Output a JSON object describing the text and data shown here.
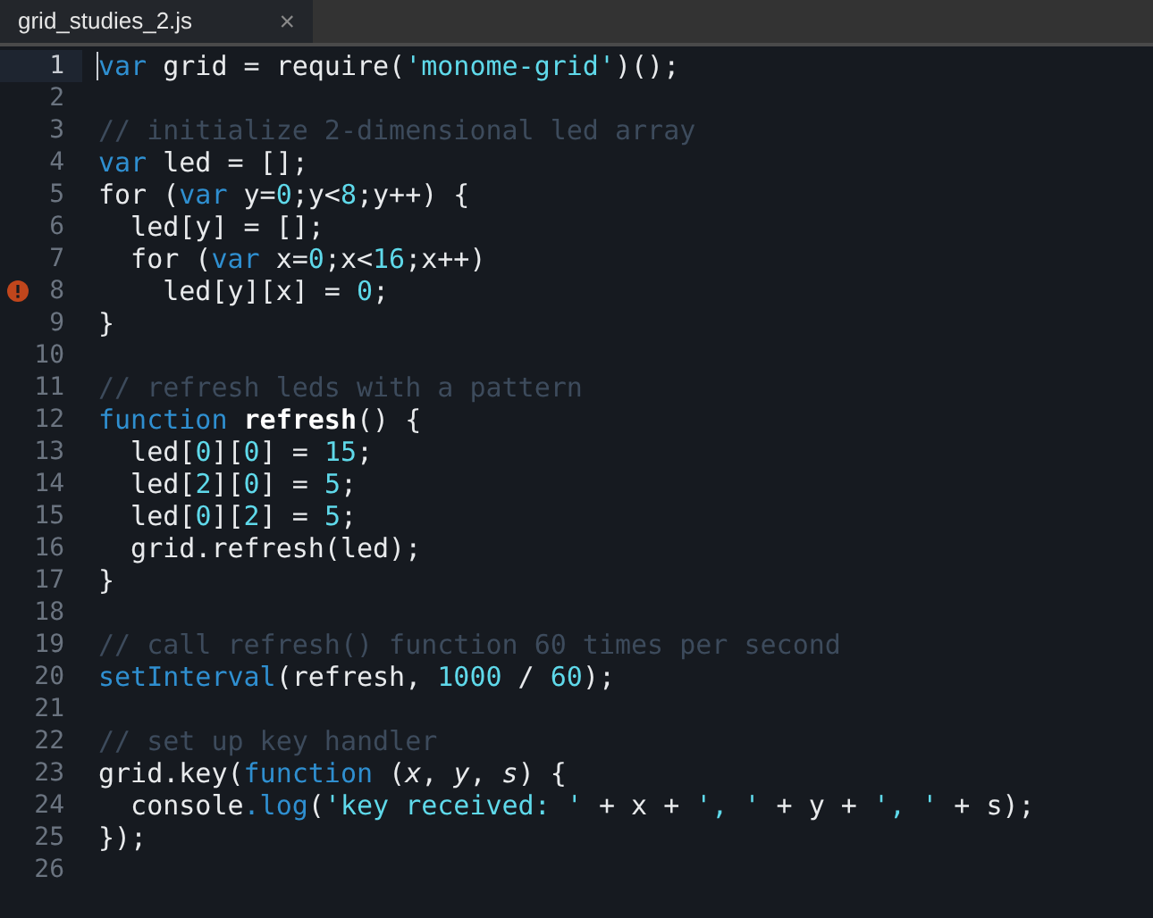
{
  "tabs": [
    {
      "label": "grid_studies_2.js",
      "close": "×",
      "selected": true
    }
  ],
  "lines": [
    {
      "number": "1",
      "current": true,
      "error": false,
      "tokens": [
        {
          "kind": "kw",
          "text": "var"
        },
        {
          "kind": "txt",
          "text": " grid = require("
        },
        {
          "kind": "str",
          "text": "'monome-grid'"
        },
        {
          "kind": "txt",
          "text": ")();"
        }
      ]
    },
    {
      "number": "2",
      "current": false,
      "error": false
    },
    {
      "number": "3",
      "current": false,
      "error": false,
      "tokens": [
        {
          "kind": "com",
          "text": "// initialize 2-dimensional led array"
        }
      ]
    },
    {
      "number": "4",
      "current": false,
      "error": false,
      "tokens": [
        {
          "kind": "kw",
          "text": "var"
        },
        {
          "kind": "txt",
          "text": " led = [];"
        }
      ]
    },
    {
      "number": "5",
      "current": false,
      "error": false,
      "tokens": [
        {
          "kind": "txt",
          "text": "for ("
        },
        {
          "kind": "kw",
          "text": "var"
        },
        {
          "kind": "txt",
          "text": " y="
        },
        {
          "kind": "num",
          "text": "0"
        },
        {
          "kind": "txt",
          "text": ";y<"
        },
        {
          "kind": "num",
          "text": "8"
        },
        {
          "kind": "txt",
          "text": ";y++) {"
        }
      ]
    },
    {
      "number": "6",
      "current": false,
      "error": false,
      "tokens": [
        {
          "kind": "txt",
          "text": "  led[y] = [];"
        }
      ]
    },
    {
      "number": "7",
      "current": false,
      "error": false,
      "tokens": [
        {
          "kind": "txt",
          "text": "  for ("
        },
        {
          "kind": "kw",
          "text": "var"
        },
        {
          "kind": "txt",
          "text": " x="
        },
        {
          "kind": "num",
          "text": "0"
        },
        {
          "kind": "txt",
          "text": ";x<"
        },
        {
          "kind": "num",
          "text": "16"
        },
        {
          "kind": "txt",
          "text": ";x++)"
        }
      ]
    },
    {
      "number": "8",
      "current": false,
      "error": true,
      "tokens": [
        {
          "kind": "txt",
          "text": "    led[y][x] = "
        },
        {
          "kind": "num",
          "text": "0"
        },
        {
          "kind": "txt",
          "text": ";"
        }
      ]
    },
    {
      "number": "9",
      "current": false,
      "error": false,
      "tokens": [
        {
          "kind": "txt",
          "text": "}"
        }
      ]
    },
    {
      "number": "10",
      "current": false,
      "error": false
    },
    {
      "number": "11",
      "current": false,
      "error": false,
      "tokens": [
        {
          "kind": "com",
          "text": "// refresh leds with a pattern"
        }
      ]
    },
    {
      "number": "12",
      "current": false,
      "error": false,
      "tokens": [
        {
          "kind": "kw",
          "text": "function"
        },
        {
          "kind": "fn",
          "text": " refresh"
        },
        {
          "kind": "txt",
          "text": "() {"
        }
      ]
    },
    {
      "number": "13",
      "current": false,
      "error": false,
      "tokens": [
        {
          "kind": "txt",
          "text": "  led["
        },
        {
          "kind": "num",
          "text": "0"
        },
        {
          "kind": "txt",
          "text": "]["
        },
        {
          "kind": "num",
          "text": "0"
        },
        {
          "kind": "txt",
          "text": "] = "
        },
        {
          "kind": "num",
          "text": "15"
        },
        {
          "kind": "txt",
          "text": ";"
        }
      ]
    },
    {
      "number": "14",
      "current": false,
      "error": false,
      "tokens": [
        {
          "kind": "txt",
          "text": "  led["
        },
        {
          "kind": "num",
          "text": "2"
        },
        {
          "kind": "txt",
          "text": "]["
        },
        {
          "kind": "num",
          "text": "0"
        },
        {
          "kind": "txt",
          "text": "] = "
        },
        {
          "kind": "num",
          "text": "5"
        },
        {
          "kind": "txt",
          "text": ";"
        }
      ]
    },
    {
      "number": "15",
      "current": false,
      "error": false,
      "tokens": [
        {
          "kind": "txt",
          "text": "  led["
        },
        {
          "kind": "num",
          "text": "0"
        },
        {
          "kind": "txt",
          "text": "]["
        },
        {
          "kind": "num",
          "text": "2"
        },
        {
          "kind": "txt",
          "text": "] = "
        },
        {
          "kind": "num",
          "text": "5"
        },
        {
          "kind": "txt",
          "text": ";"
        }
      ]
    },
    {
      "number": "16",
      "current": false,
      "error": false,
      "tokens": [
        {
          "kind": "txt",
          "text": "  grid.refresh(led);"
        }
      ]
    },
    {
      "number": "17",
      "current": false,
      "error": false,
      "tokens": [
        {
          "kind": "txt",
          "text": "}"
        }
      ]
    },
    {
      "number": "18",
      "current": false,
      "error": false
    },
    {
      "number": "19",
      "current": false,
      "error": false,
      "tokens": [
        {
          "kind": "com",
          "text": "// call refresh() function 60 times per second"
        }
      ]
    },
    {
      "number": "20",
      "current": false,
      "error": false,
      "tokens": [
        {
          "kind": "kw",
          "text": "setInterval"
        },
        {
          "kind": "txt",
          "text": "(refresh, "
        },
        {
          "kind": "num",
          "text": "1000"
        },
        {
          "kind": "txt",
          "text": " / "
        },
        {
          "kind": "num",
          "text": "60"
        },
        {
          "kind": "txt",
          "text": ");"
        }
      ]
    },
    {
      "number": "21",
      "current": false,
      "error": false
    },
    {
      "number": "22",
      "current": false,
      "error": false,
      "tokens": [
        {
          "kind": "com",
          "text": "// set up key handler"
        }
      ]
    },
    {
      "number": "23",
      "current": false,
      "error": false,
      "tokens": [
        {
          "kind": "txt",
          "text": "grid.key("
        },
        {
          "kind": "kw",
          "text": "function"
        },
        {
          "kind": "txt",
          "text": " ("
        },
        {
          "kind": "param",
          "text": "x"
        },
        {
          "kind": "txt",
          "text": ", "
        },
        {
          "kind": "param",
          "text": "y"
        },
        {
          "kind": "txt",
          "text": ", "
        },
        {
          "kind": "param",
          "text": "s"
        },
        {
          "kind": "txt",
          "text": ") {"
        }
      ]
    },
    {
      "number": "24",
      "current": false,
      "error": false,
      "tokens": [
        {
          "kind": "txt",
          "text": "  console"
        },
        {
          "kind": "kw",
          "text": ".log"
        },
        {
          "kind": "txt",
          "text": "("
        },
        {
          "kind": "str",
          "text": "'key received: '"
        },
        {
          "kind": "txt",
          "text": " + x + "
        },
        {
          "kind": "str",
          "text": "', '"
        },
        {
          "kind": "txt",
          "text": " + y + "
        },
        {
          "kind": "str",
          "text": "', '"
        },
        {
          "kind": "txt",
          "text": " + s);"
        }
      ]
    },
    {
      "number": "25",
      "current": false,
      "error": false,
      "tokens": [
        {
          "kind": "txt",
          "text": "});"
        }
      ]
    },
    {
      "number": "26",
      "current": false,
      "error": false
    }
  ]
}
